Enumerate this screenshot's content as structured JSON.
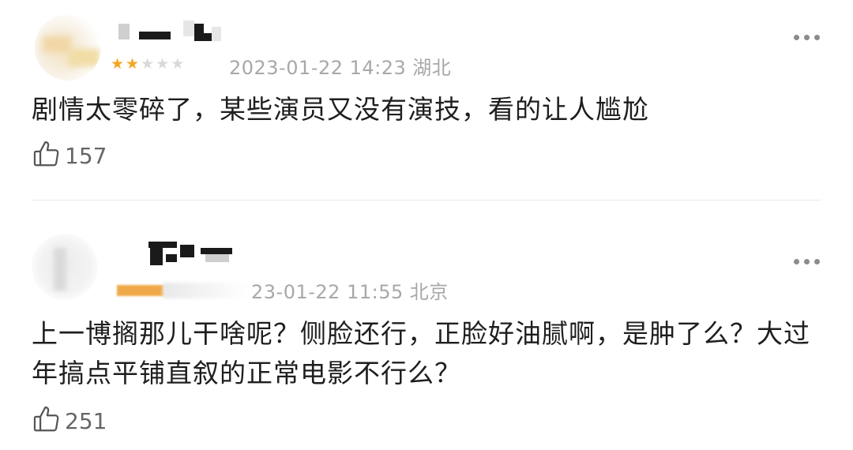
{
  "comments": [
    {
      "rating_stars": 2,
      "rating_max": 5,
      "date": "2023-01-22 14:23",
      "location": "湖北",
      "text": "剧情太零碎了，某些演员又没有演技，看的让人尴尬",
      "likes": "157",
      "icons": {
        "like": "thumbs-up-icon",
        "more": "more-dots-icon"
      }
    },
    {
      "date": "23-01-22 11:55",
      "location": "北京",
      "text": "上一博搁那儿干啥呢？侧脸还行，正脸好油腻啊，是肿了么？大过年搞点平铺直叙的正常电影不行么？",
      "likes": "251",
      "icons": {
        "like": "thumbs-up-icon",
        "more": "more-dots-icon"
      }
    }
  ],
  "colors": {
    "star_on": "#f5a623",
    "star_off": "#d9d9d9",
    "meta_text": "#a8a8a8",
    "body_text": "#1e1e1e"
  }
}
